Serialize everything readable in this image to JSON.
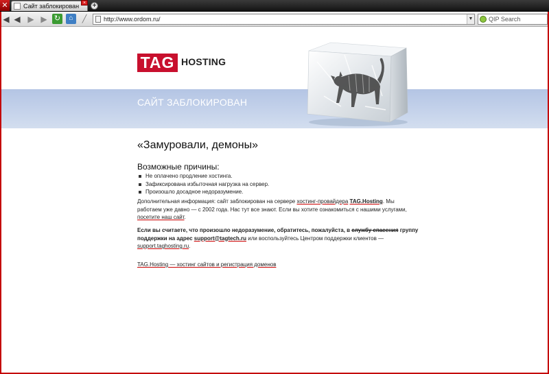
{
  "browser": {
    "tab_title": "Сайт заблокирован",
    "tab_close": "×",
    "new_tab": "+",
    "url": "http://www.ordom.ru/",
    "search_placeholder": "QIP Search",
    "icons": [
      "close-window-icon",
      "page-icon",
      "back-icon",
      "rewind-icon",
      "forward-icon",
      "fast-forward-icon",
      "reload-icon",
      "home-icon",
      "wand-icon",
      "dropdown-icon",
      "qip-search-icon"
    ],
    "frame_color": "#c40000"
  },
  "page": {
    "logo_tag": "TAG",
    "logo_hosting": "HOSTING",
    "banner_title": "САЙТ ЗАБЛОКИРОВАН",
    "heading": "«Замуровали, демоны»",
    "reasons_title": "Возможные причины:",
    "reasons": [
      "Не оплачено продление хостинга.",
      "Зафиксирована избыточная нагрузка на сервер.",
      "Произошло досадное недоразумение."
    ],
    "info": {
      "text1": "Дополнительная информация: сайт заблокирован на сервере ",
      "link1": "хостинг-провайдера",
      "brand": "TAG.Hosting",
      "text2": ". Мы работаем уже давно — с 2002 года. Нас тут все знают. Если вы хотите ознакомиться с нашими услугами, ",
      "link2": "посетите наш сайт",
      "text3": "."
    },
    "support": {
      "text1": "Если вы считаете, что произошло недоразумение, обратитесь, пожалуйста, в ",
      "strike": "службу спасения",
      "text2": " группу поддержки на адрес ",
      "email": "support@tagtech.ru",
      "text3": " или воспользуйтесь Центром поддержки клиентов — ",
      "link": "support.taghosting.ru",
      "text4": "."
    },
    "footer_link": "TAG.Hosting — хостинг сайтов и регистрация доменов",
    "colors": {
      "brand_red": "#c8102e",
      "banner_blue": "#c3d1ea"
    }
  }
}
